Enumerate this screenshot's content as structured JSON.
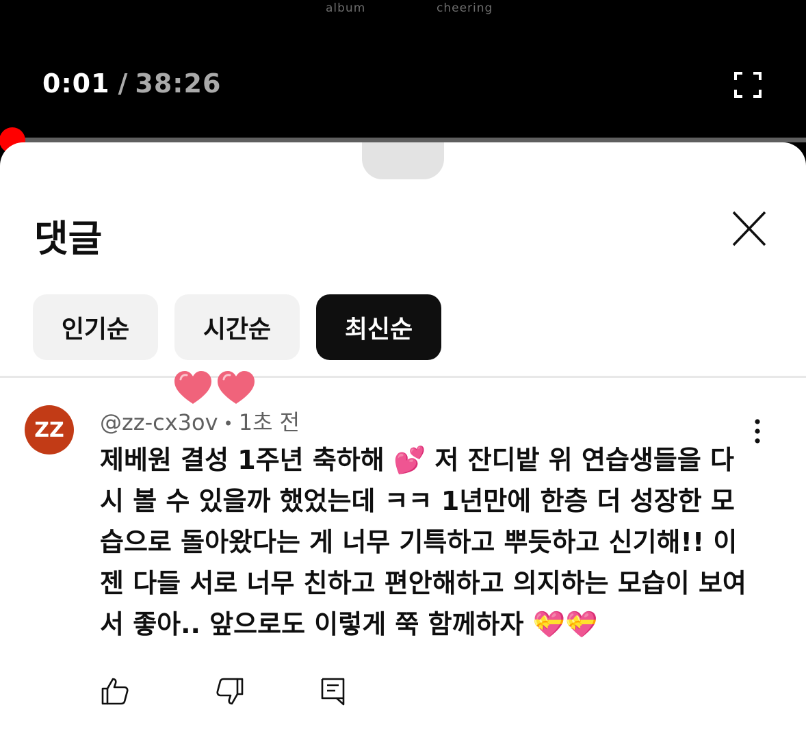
{
  "player": {
    "video_captions": [
      "album",
      "cheering"
    ],
    "current_time": "0:01",
    "separator": "/",
    "duration": "38:26",
    "progress_fraction": 0.0004,
    "accent_color": "#ff0000",
    "fullscreen_icon": "fullscreen-icon"
  },
  "comments_sheet": {
    "title": "댓글",
    "close_icon": "close-icon",
    "sort_chips": [
      {
        "label": "인기순",
        "selected": false
      },
      {
        "label": "시간순",
        "selected": false
      },
      {
        "label": "최신순",
        "selected": true
      }
    ],
    "comment": {
      "avatar_text": "ZZ",
      "avatar_color": "#c23b16",
      "author": "@zz-cx3ov",
      "meta_separator": "•",
      "time_ago": "1초 전",
      "text": "제베원 결성 1주년 축하해 💕 저 잔디밭 위 연습생들을 다시 볼 수 있을까 했었는데 ㅋㅋ 1년만에 한층 더 성장한 모습으로 돌아왔다는 게 너무 기특하고 뿌듯하고 신기해!! 이젠 다들 서로 너무 친하고 편안해하고 의지하는 모습이 보여서 좋아.. 앞으로도 이렇게 쭉 함께하자 💝💝",
      "actions": [
        "like-icon",
        "dislike-icon",
        "reply-icon"
      ],
      "more_icon": "more-vert-icon"
    },
    "decorations": [
      "heart-sticker-icon",
      "heart-sticker-icon"
    ]
  }
}
